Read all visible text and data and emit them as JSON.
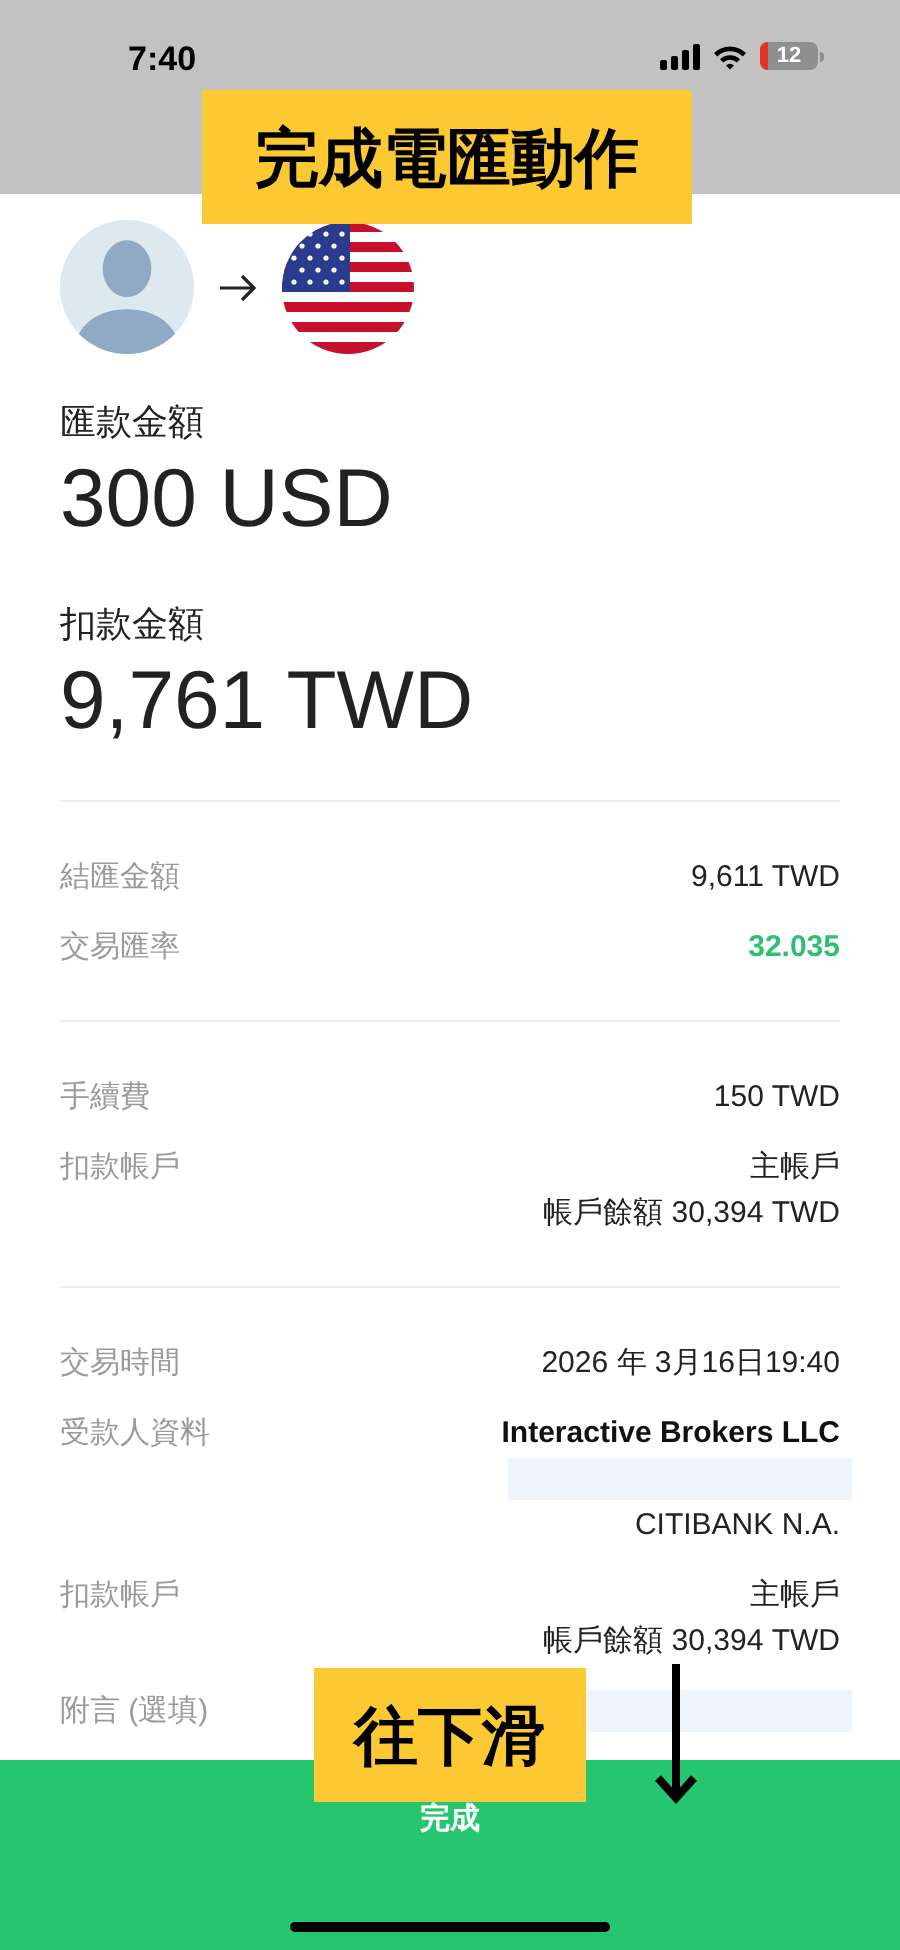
{
  "status_bar": {
    "time": "7:40",
    "battery": "12"
  },
  "amounts": [
    {
      "label": "匯款金額",
      "value": "300 USD"
    },
    {
      "label": "扣款金額",
      "value": "9,761 TWD"
    }
  ],
  "sections": [
    {
      "rows": [
        {
          "label": "結匯金額",
          "lines": [
            {
              "kind": "text",
              "text": "9,611 TWD"
            }
          ]
        },
        {
          "label": "交易匯率",
          "lines": [
            {
              "kind": "rate",
              "text": "32.035"
            }
          ]
        }
      ]
    },
    {
      "rows": [
        {
          "label": "手續費",
          "lines": [
            {
              "kind": "text",
              "text": "150 TWD"
            }
          ]
        },
        {
          "label": "扣款帳戶",
          "lines": [
            {
              "kind": "text",
              "text": "主帳戶"
            },
            {
              "kind": "text",
              "text": "帳戶餘額 30,394 TWD"
            }
          ]
        }
      ]
    },
    {
      "rows": [
        {
          "label": "交易時間",
          "lines": [
            {
              "kind": "text",
              "text": "2026 年 3月16日19:40"
            }
          ]
        },
        {
          "label": "受款人資料",
          "lines": [
            {
              "kind": "name",
              "text": "Interactive Brokers LLC"
            },
            {
              "kind": "redacted"
            },
            {
              "kind": "text",
              "text": "CITIBANK N.A."
            }
          ]
        },
        {
          "label": "扣款帳戶",
          "lines": [
            {
              "kind": "text",
              "text": "主帳戶"
            },
            {
              "kind": "text",
              "text": "帳戶餘額 30,394 TWD"
            }
          ]
        },
        {
          "label": "附言 (選填)",
          "lines": [
            {
              "kind": "redacted"
            }
          ]
        }
      ]
    }
  ],
  "done_button": "完成",
  "annotations": [
    {
      "kind": "label",
      "text": "完成電匯動作"
    },
    {
      "kind": "label_with_arrow",
      "text": "往下滑"
    }
  ]
}
